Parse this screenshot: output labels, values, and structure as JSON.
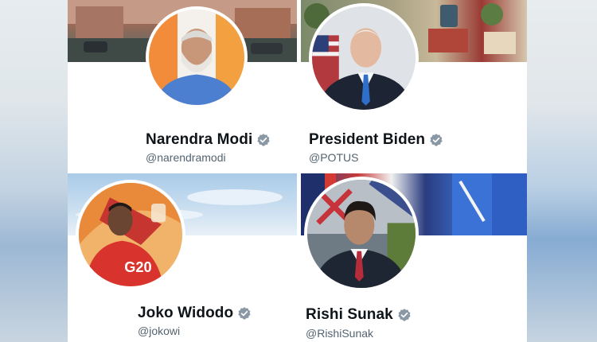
{
  "profiles": [
    {
      "name": "Narendra Modi",
      "handle": "@narendramodi"
    },
    {
      "name": "President Biden",
      "handle": "@POTUS"
    },
    {
      "name": "Joko Widodo",
      "handle": "@jokowi"
    },
    {
      "name": "Rishi Sunak",
      "handle": "@RishiSunak"
    }
  ],
  "badges": {
    "avatar_3": "G20"
  },
  "colors": {
    "verified": "#8a98a5",
    "name_text": "#0f1419",
    "handle_text": "#536471"
  },
  "icons": {
    "verified": "verified-badge-icon"
  }
}
